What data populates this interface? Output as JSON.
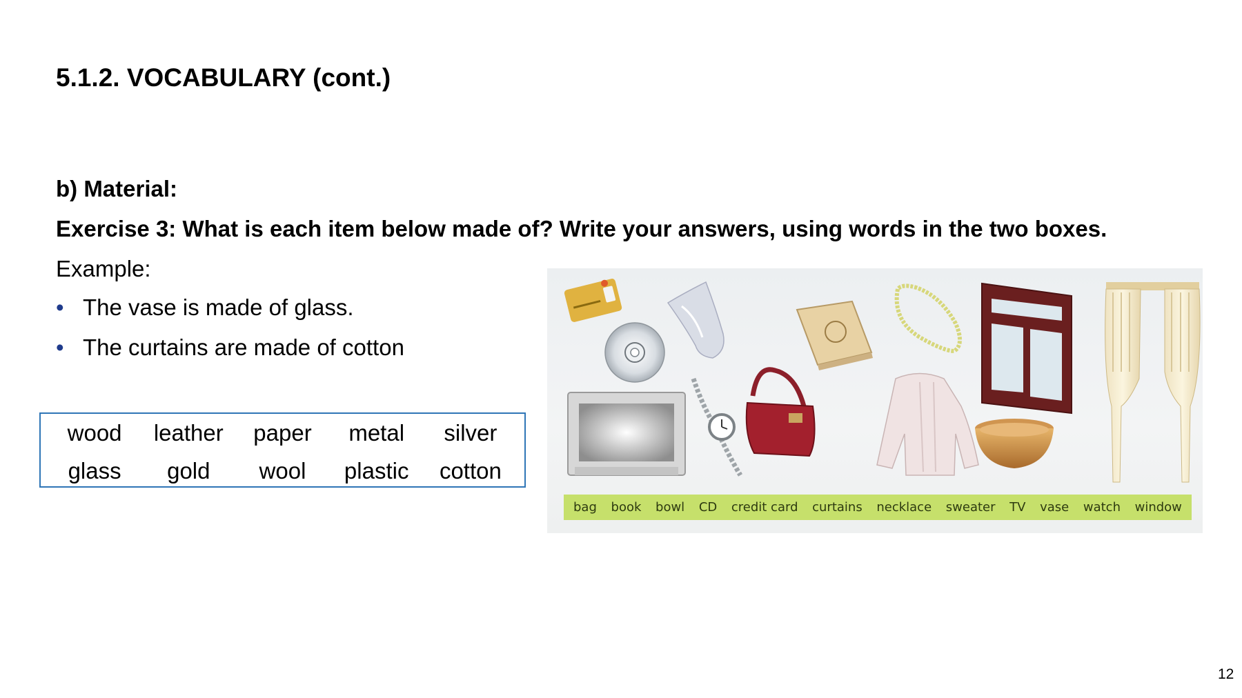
{
  "slide": {
    "title": "5.1.2. VOCABULARY (cont.)",
    "subheading": "b) Material:",
    "exercise": "Exercise 3: What is each item below made of? Write your answers, using words in the two boxes.",
    "example_label": "Example:",
    "examples": [
      "The vase is made of glass.",
      "The curtains are made of cotton"
    ],
    "bullet": "•",
    "page_number": "12"
  },
  "word_box": {
    "rows": [
      [
        "wood",
        "leather",
        "paper",
        "metal",
        "silver"
      ],
      [
        "glass",
        "gold",
        "wool",
        "plastic",
        "cotton"
      ]
    ]
  },
  "picture": {
    "item_labels": [
      "bag",
      "book",
      "bowl",
      "CD",
      "credit card",
      "curtains",
      "necklace",
      "sweater",
      "TV",
      "vase",
      "watch",
      "window"
    ],
    "label_bar_color": "#c6e06b"
  }
}
